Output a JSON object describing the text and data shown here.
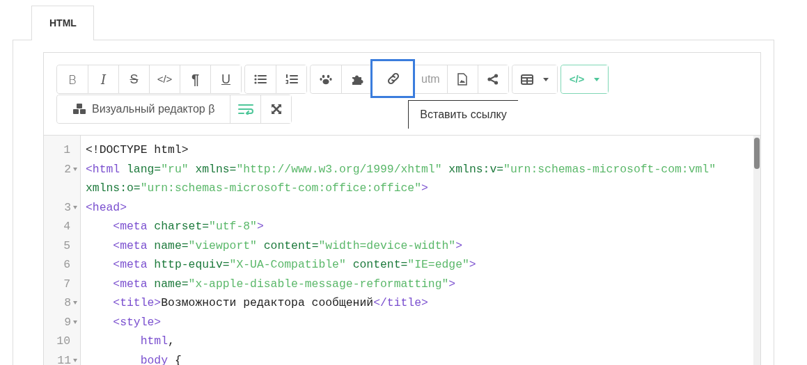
{
  "tab": {
    "label": "HTML",
    "selected": true
  },
  "toolbar": {
    "rows": [
      [
        {
          "buttons": [
            {
              "label": "B",
              "active": false,
              "highlighted": false
            },
            {
              "label": "I",
              "active": false,
              "highlighted": false
            },
            {
              "label": "S",
              "active": false,
              "highlighted": false
            },
            {
              "label": "</>",
              "active": false,
              "highlighted": false
            },
            {
              "label": "¶",
              "active": false,
              "highlighted": false
            },
            {
              "label": "U",
              "active": false,
              "highlighted": false
            }
          ]
        },
        {
          "buttons": [
            {
              "active": false,
              "highlighted": false
            },
            {
              "active": false,
              "highlighted": false
            }
          ]
        },
        {
          "buttons": [
            {
              "active": false,
              "highlighted": false
            },
            {
              "active": false,
              "highlighted": false
            },
            {
              "active": false,
              "highlighted": true
            },
            {
              "label": "utm",
              "active": false,
              "highlighted": false
            },
            {
              "active": false,
              "highlighted": false
            },
            {
              "active": false,
              "highlighted": false
            }
          ]
        },
        {
          "buttons": [
            {
              "active": false,
              "highlighted": false,
              "dropdown": true
            }
          ]
        },
        {
          "buttons": [
            {
              "label": "</>",
              "active": true,
              "highlighted": false,
              "dropdown": true
            }
          ]
        }
      ],
      [
        {
          "buttons": [
            {
              "label": "Визуальный редактор β",
              "active": false,
              "highlighted": false
            },
            {
              "active": true,
              "highlighted": false
            },
            {
              "active": false,
              "highlighted": false
            }
          ]
        }
      ]
    ]
  },
  "tooltip": "Вставить ссылку",
  "code": {
    "lines": [
      {
        "number": "1",
        "foldable": false,
        "wraps": [
          {
            "tokens": [
              {
                "kind": "txt",
                "text": "<!DOCTYPE html>"
              }
            ]
          }
        ]
      },
      {
        "number": "2",
        "foldable": true,
        "wraps": [
          {
            "tokens": [
              {
                "kind": "tag",
                "text": "<html"
              },
              {
                "kind": "attr",
                "text": " lang="
              },
              {
                "kind": "str",
                "text": "\"ru\""
              },
              {
                "kind": "attr",
                "text": " xmlns="
              },
              {
                "kind": "str",
                "text": "\"http://www.w3.org/1999/xhtml\""
              },
              {
                "kind": "attr",
                "text": " xmlns:v="
              },
              {
                "kind": "str",
                "text": "\"urn:schemas-microsoft-com:vml\""
              }
            ]
          },
          {
            "tokens": [
              {
                "kind": "attr",
                "text": "xmlns:o="
              },
              {
                "kind": "str",
                "text": "\"urn:schemas-microsoft-com:office:office\""
              },
              {
                "kind": "tag",
                "text": ">"
              }
            ]
          }
        ]
      },
      {
        "number": "3",
        "foldable": true,
        "wraps": [
          {
            "tokens": [
              {
                "kind": "tag",
                "text": "<head>"
              }
            ]
          }
        ]
      },
      {
        "number": "4",
        "foldable": false,
        "wraps": [
          {
            "tokens": [
              {
                "kind": "tag",
                "text": "    <meta"
              },
              {
                "kind": "attr",
                "text": " charset="
              },
              {
                "kind": "str",
                "text": "\"utf-8\""
              },
              {
                "kind": "tag",
                "text": ">"
              }
            ]
          }
        ]
      },
      {
        "number": "5",
        "foldable": false,
        "wraps": [
          {
            "tokens": [
              {
                "kind": "tag",
                "text": "    <meta"
              },
              {
                "kind": "attr",
                "text": " name="
              },
              {
                "kind": "str",
                "text": "\"viewport\""
              },
              {
                "kind": "attr",
                "text": " content="
              },
              {
                "kind": "str",
                "text": "\"width=device-width\""
              },
              {
                "kind": "tag",
                "text": ">"
              }
            ]
          }
        ]
      },
      {
        "number": "6",
        "foldable": false,
        "wraps": [
          {
            "tokens": [
              {
                "kind": "tag",
                "text": "    <meta"
              },
              {
                "kind": "attr",
                "text": " http-equiv="
              },
              {
                "kind": "str",
                "text": "\"X-UA-Compatible\""
              },
              {
                "kind": "attr",
                "text": " content="
              },
              {
                "kind": "str",
                "text": "\"IE=edge\""
              },
              {
                "kind": "tag",
                "text": ">"
              }
            ]
          }
        ]
      },
      {
        "number": "7",
        "foldable": false,
        "wraps": [
          {
            "tokens": [
              {
                "kind": "tag",
                "text": "    <meta"
              },
              {
                "kind": "attr",
                "text": " name="
              },
              {
                "kind": "str",
                "text": "\"x-apple-disable-message-reformatting\""
              },
              {
                "kind": "tag",
                "text": ">"
              }
            ]
          }
        ]
      },
      {
        "number": "8",
        "foldable": true,
        "wraps": [
          {
            "tokens": [
              {
                "kind": "tag",
                "text": "    <title>"
              },
              {
                "kind": "txt",
                "text": "Возможности редактора сообщений"
              },
              {
                "kind": "tag",
                "text": "</title>"
              }
            ]
          }
        ]
      },
      {
        "number": "9",
        "foldable": true,
        "wraps": [
          {
            "tokens": [
              {
                "kind": "tag",
                "text": "    <style>"
              }
            ]
          }
        ]
      },
      {
        "number": "10",
        "foldable": false,
        "wraps": [
          {
            "tokens": [
              {
                "kind": "tag",
                "text": "        html"
              },
              {
                "kind": "txt",
                "text": ","
              }
            ]
          }
        ]
      },
      {
        "number": "11",
        "foldable": true,
        "wraps": [
          {
            "tokens": [
              {
                "kind": "tag",
                "text": "        body"
              },
              {
                "kind": "txt",
                "text": " {"
              }
            ]
          }
        ]
      }
    ]
  }
}
